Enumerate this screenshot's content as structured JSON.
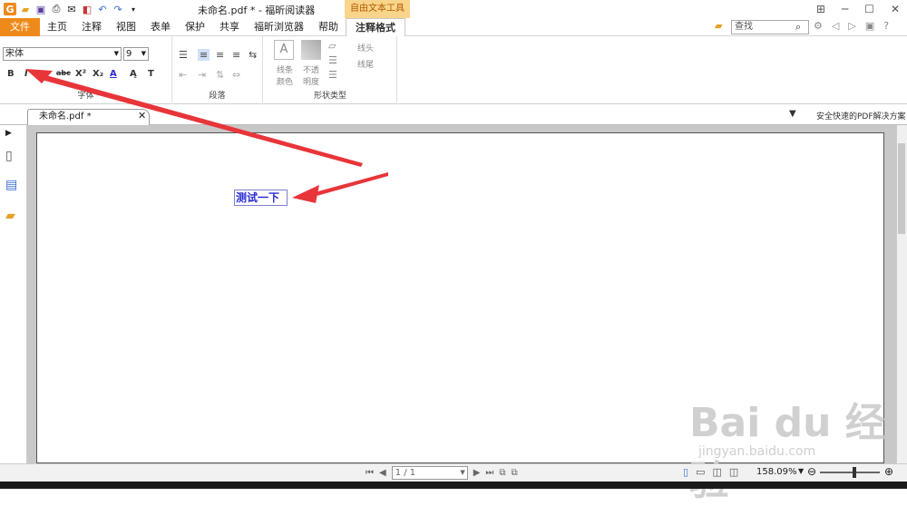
{
  "window": {
    "title": "未命名.pdf * - 福昕阅读器",
    "context_tab": "自由文本工具"
  },
  "menu": {
    "file": "文件",
    "tabs": [
      "主页",
      "注释",
      "视图",
      "表单",
      "保护",
      "共享",
      "福昕浏览器",
      "帮助",
      "注释格式"
    ],
    "active_tab": "注释格式"
  },
  "search": {
    "placeholder": "查找"
  },
  "ribbon": {
    "font": {
      "name": "宋体",
      "size": "9",
      "label": "字体",
      "bold": "B",
      "italic": "I",
      "strike": "abc",
      "sup": "X²",
      "sub": "X₂"
    },
    "paragraph": {
      "label": "段落"
    },
    "shape": {
      "label": "形状类型",
      "line_color": "线条\n颜色",
      "opacity": "不透\n明度",
      "line_start": "线头",
      "line_end": "线尾"
    }
  },
  "document": {
    "tab_name": "未命名.pdf *",
    "promo": "安全快速的PDF解决方案",
    "text_content": "测试一下"
  },
  "status": {
    "page": "1 / 1",
    "zoom": "158.09%"
  },
  "watermark": {
    "text": "Bai du 经验",
    "url": "jingyan.baidu.com"
  },
  "colors": {
    "file_button": "#ee8a1b",
    "context_tab": "#f9d48b",
    "text_blue": "#2b2bd6",
    "arrow": "#e8353a"
  }
}
